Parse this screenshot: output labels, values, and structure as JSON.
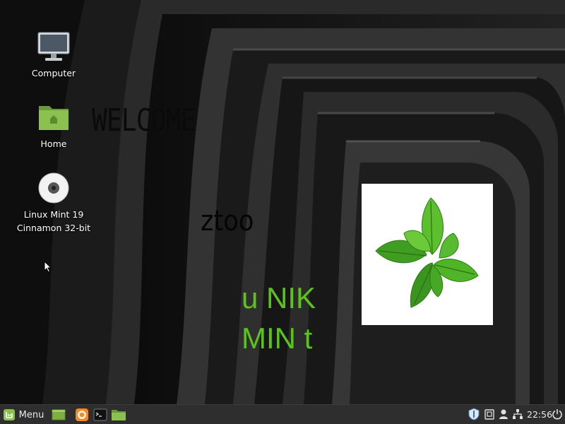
{
  "desktop": {
    "icons": [
      {
        "label": "Computer",
        "icon": "monitor-icon"
      },
      {
        "label": "Home",
        "icon": "folder-icon"
      },
      {
        "label": "Linux Mint 19\nCinnamon 32-bit",
        "icon": "disc-icon"
      }
    ],
    "wallpaper_text": {
      "welcome": "WELCOME",
      "ztoo": "ztoo",
      "green_line_1": "u NIK",
      "green_line_2": "MIN t"
    },
    "colors": {
      "green_text": "#5cc21c",
      "mint_leaf": "#4caf2a"
    }
  },
  "panel": {
    "menu_label": "Menu",
    "launchers": [
      "show-desktop-icon",
      "firefox-icon",
      "terminal-icon",
      "files-icon"
    ],
    "tray": [
      "shield-icon",
      "clipboard-icon",
      "user-icon",
      "network-icon"
    ],
    "clock": "22:56",
    "power_icon": "power-icon"
  }
}
